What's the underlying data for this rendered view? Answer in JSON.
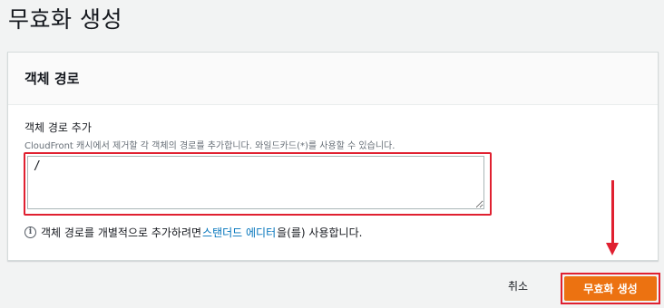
{
  "page": {
    "title": "무효화 생성"
  },
  "panel": {
    "title": "객체 경로",
    "field_label": "객체 경로 추가",
    "field_description": "CloudFront 캐시에서 제거할 각 객체의 경로를 추가합니다. 와일드카드(*)를 사용할 수 있습니다.",
    "textarea_value": "/",
    "info": {
      "prefix": "객체 경로를 개별적으로 추가하려면",
      "link_text": "스탠더드 에디터",
      "suffix": "을(를) 사용합니다.",
      "icon": "info-icon"
    }
  },
  "actions": {
    "cancel_label": "취소",
    "submit_label": "무효화 생성"
  },
  "colors": {
    "accent": "#ec7211",
    "link": "#0073bb",
    "annotation": "#e02030"
  }
}
